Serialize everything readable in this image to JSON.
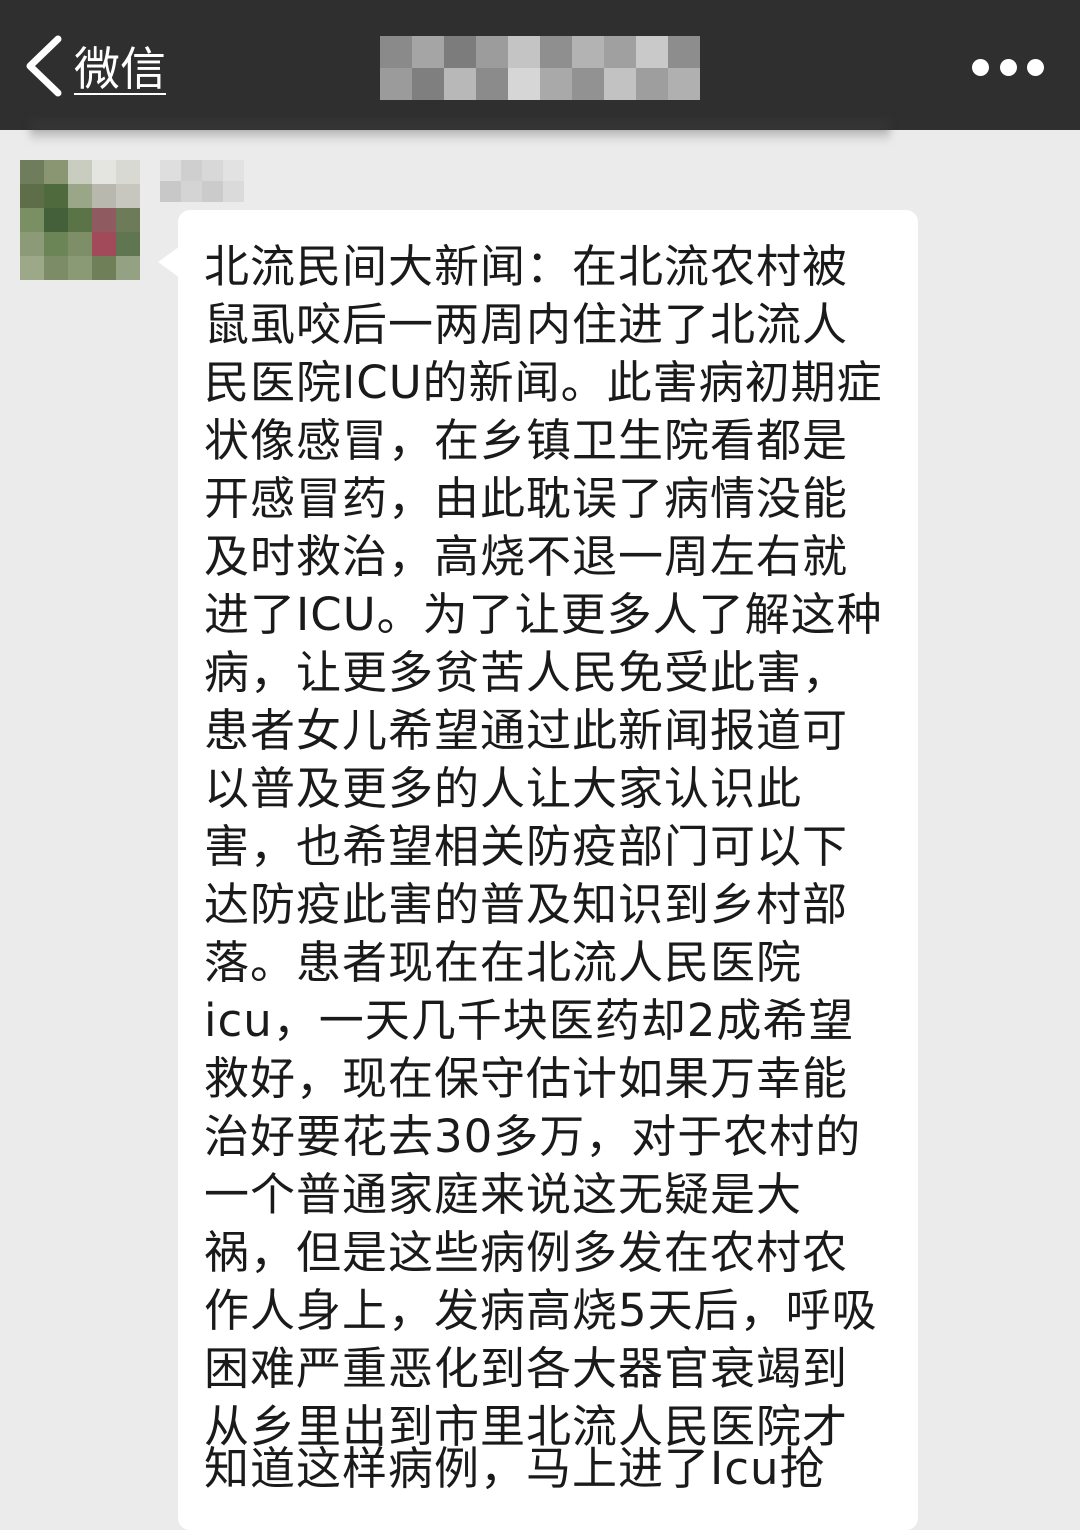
{
  "navbar": {
    "back_label": "微信",
    "back_icon": "chevron-left-icon",
    "more_icon": "more-dots-icon",
    "background_color": "#2f2f2f"
  },
  "chat": {
    "background_color": "#ebebeb",
    "bubble_color": "#ffffff",
    "message_lines": [
      "北流民间大新闻：在北流农村被",
      "鼠虱咬后一两周内住进了北流人",
      "民医院ICU的新闻。此害病初期症",
      "状像感冒，在乡镇卫生院看都是",
      "开感冒药，由此耽误了病情没能",
      "及时救治，高烧不退一周左右就",
      "进了ICU。为了让更多人了解这种",
      "病，让更多贫苦人民免受此害，",
      "患者女儿希望通过此新闻报道可",
      "以普及更多的人让大家认识此",
      "害，也希望相关防疫部门可以下",
      "达防疫此害的普及知识到乡村部",
      "落。患者现在在北流人民医院",
      "icu，一天几千块医药却2成希望",
      "救好，现在保守估计如果万幸能",
      "治好要花去30多万，对于农村的",
      "一个普通家庭来说这无疑是大",
      "祸，但是这些病例多发在农村农",
      "作人身上，发病高烧5天后，呼吸",
      "困难严重恶化到各大器官衰竭到",
      "从乡里出到市里北流人民医院才",
      "知道这样病例，马上进了Icu抢"
    ]
  }
}
